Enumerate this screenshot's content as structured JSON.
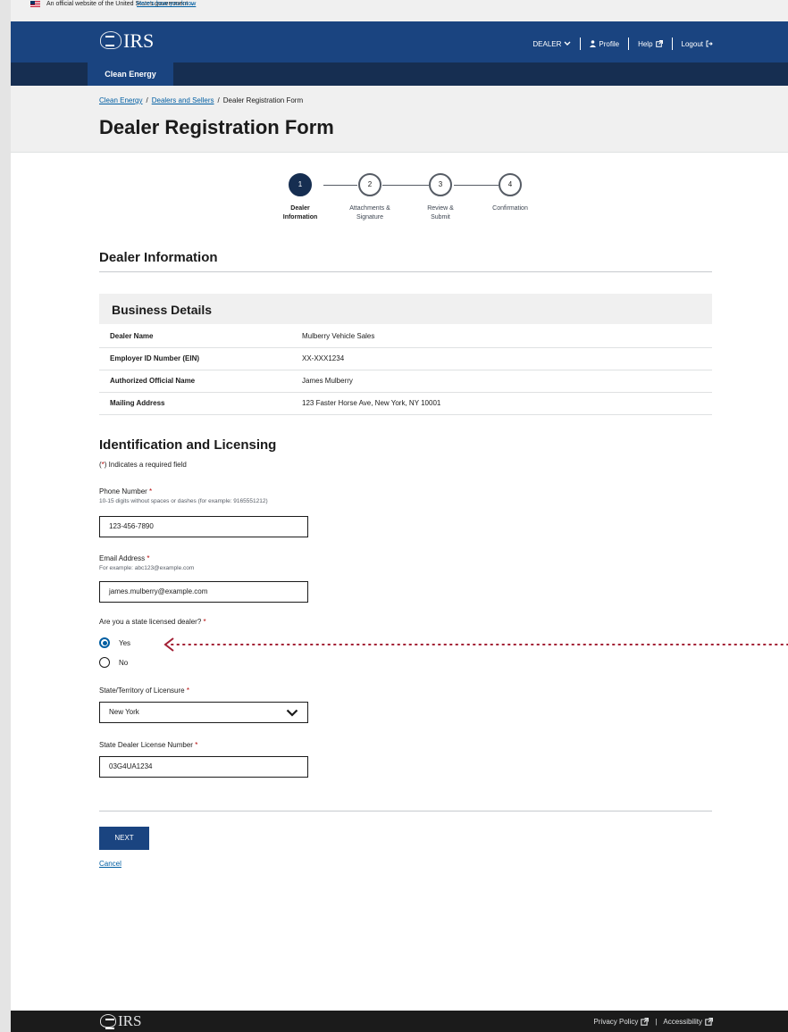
{
  "gov_banner": {
    "text": "An official website of the United States government",
    "link": "Here's how you know"
  },
  "header": {
    "logo": "IRS",
    "nav": {
      "dealer": "DEALER",
      "profile": "Profile",
      "help": "Help",
      "logout": "Logout"
    }
  },
  "tabs": [
    {
      "label": "Clean Energy"
    }
  ],
  "breadcrumb": [
    "Clean Energy",
    "Dealers and Sellers",
    "Dealer Registration Form"
  ],
  "page_title": "Dealer Registration Form",
  "stepper": [
    {
      "num": "1",
      "label1": "Dealer",
      "label2": "Information",
      "active": true
    },
    {
      "num": "2",
      "label1": "Attachments &",
      "label2": "Signature",
      "active": false
    },
    {
      "num": "3",
      "label1": "Review &",
      "label2": "Submit",
      "active": false
    },
    {
      "num": "4",
      "label1": "Confirmation",
      "label2": "",
      "active": false
    }
  ],
  "dealer_info_heading": "Dealer Information",
  "business": {
    "heading": "Business Details",
    "rows": [
      {
        "key": "Dealer Name",
        "value": "Mulberry Vehicle Sales"
      },
      {
        "key": "Employer ID Number (EIN)",
        "value": "XX-XXX1234"
      },
      {
        "key": "Authorized Official Name",
        "value": "James Mulberry"
      },
      {
        "key": "Mailing Address",
        "value": "123 Faster Horse Ave, New York, NY 10001"
      }
    ]
  },
  "licensing": {
    "heading": "Identification and Licensing",
    "required_note_pre": "(",
    "required_note_ast": "*",
    "required_note_post": ") Indicates a required field",
    "phone": {
      "label": "Phone Number",
      "hint": "10-15 digits without spaces or dashes (for example: 9165551212)",
      "value": "123-456-7890"
    },
    "email": {
      "label": "Email Address",
      "hint": "For example: abc123@example.com",
      "value": "james.mulberry@example.com"
    },
    "licensed_question": "Are you a state licensed dealer?",
    "radio_yes": "Yes",
    "radio_no": "No",
    "state": {
      "label": "State/Territory of Licensure",
      "value": "New York"
    },
    "license": {
      "label": "State Dealer License Number",
      "value": "03G4UA1234"
    },
    "asterisk": "*"
  },
  "actions": {
    "next": "NEXT",
    "cancel": "Cancel"
  },
  "footer": {
    "logo": "IRS",
    "privacy": "Privacy Policy",
    "accessibility": "Accessibility",
    "sep": "|"
  },
  "colors": {
    "header_blue": "#1a4480",
    "tab_dark": "#162e51",
    "link": "#005ea2",
    "required_red": "#b50909",
    "annotation_red": "#a31f34"
  }
}
